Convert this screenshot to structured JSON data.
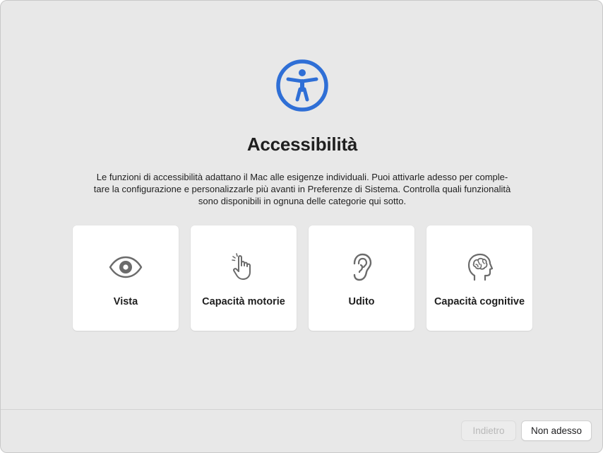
{
  "window": {
    "title": "Accessibilità",
    "description": "Le funzioni di accessibilità adattano il Mac alle esigenze individuali. Puoi attivarle adesso per comple-\ntare la configurazione e personalizzarle più avanti in Preferenze di Sistema. Controlla quali funzionalità\nsono disponibili in ognuna delle categorie qui sotto.",
    "hero_icon": "accessibility-icon",
    "accent_color": "#2f6fd6"
  },
  "categories": [
    {
      "label": "Vista",
      "icon": "eye-icon"
    },
    {
      "label": "Capacità motorie",
      "icon": "hand-pointer-icon"
    },
    {
      "label": "Udito",
      "icon": "ear-icon"
    },
    {
      "label": "Capacità cognitive",
      "icon": "brain-head-icon"
    }
  ],
  "footer": {
    "back_label": "Indietro",
    "back_enabled": false,
    "skip_label": "Non adesso"
  }
}
